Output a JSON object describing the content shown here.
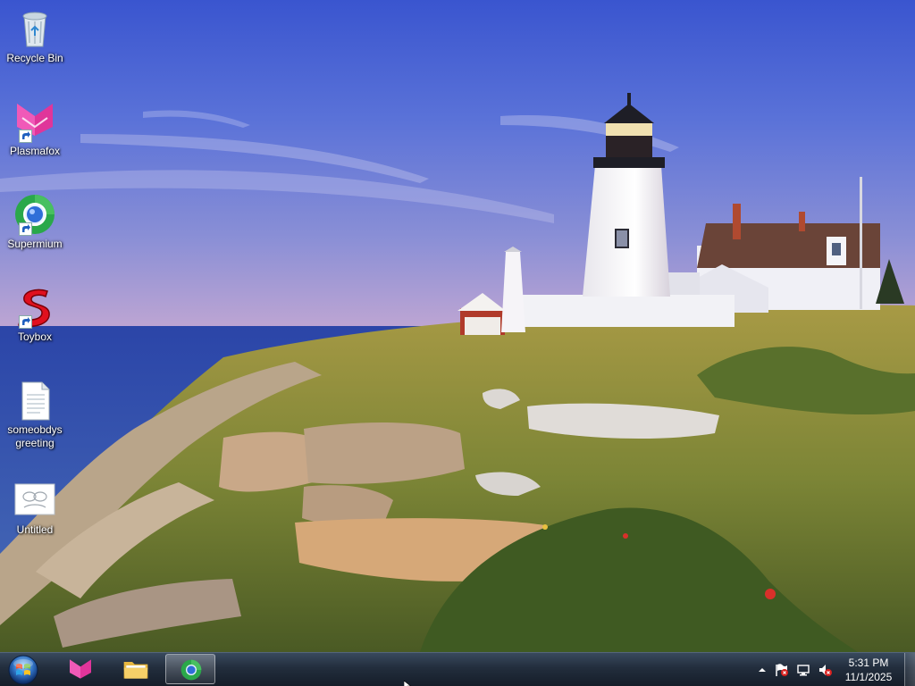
{
  "desktop": {
    "icons": [
      {
        "label": "Recycle Bin",
        "icon": "recycle-bin-icon"
      },
      {
        "label": "Plasmafox",
        "icon": "plasmafox-icon",
        "shortcut": true
      },
      {
        "label": "Supermium",
        "icon": "supermium-icon",
        "shortcut": true
      },
      {
        "label": "Toybox",
        "icon": "toybox-icon",
        "shortcut": true
      },
      {
        "label": "someobdys greeting",
        "icon": "text-document-icon"
      },
      {
        "label": "Untitled",
        "icon": "paint-image-icon"
      }
    ]
  },
  "taskbar": {
    "start": {
      "icon": "windows-orb-icon"
    },
    "pinned": [
      {
        "app": "plasmafox",
        "icon": "plasmafox-icon",
        "active": false
      },
      {
        "app": "file-explorer",
        "icon": "folder-icon",
        "active": false
      },
      {
        "app": "supermium",
        "icon": "supermium-icon",
        "active": true
      }
    ],
    "tray": {
      "icons": [
        "show-hidden-icons-chevron",
        "action-center-flag-icon",
        "network-icon",
        "volume-muted-icon"
      ],
      "time": "5:31 PM",
      "date": "11/1/2025"
    }
  },
  "colors": {
    "taskbar": "#1a2636",
    "sky_top": "#3d5bd0",
    "sea": "#2a4fa0",
    "grass": "#8a8a3a",
    "plasmafox_pink": "#e0359a",
    "toybox_red": "#e0101e"
  }
}
